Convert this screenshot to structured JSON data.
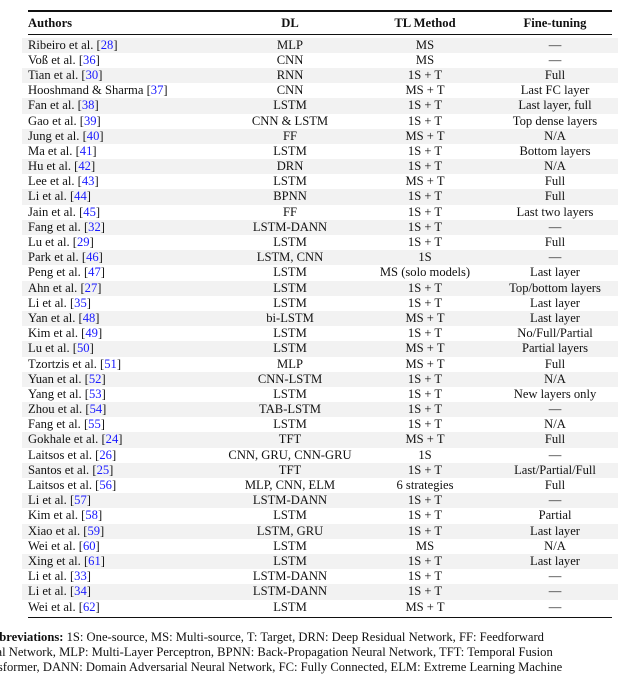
{
  "table": {
    "headers": [
      "Authors",
      "DL",
      "TL Method",
      "Fine-tuning"
    ],
    "rows": [
      {
        "author": "Ribeiro et al.",
        "ref": "28",
        "dl": "MLP",
        "tl": "MS",
        "ft": "—"
      },
      {
        "author": "Voß et al.",
        "ref": "36",
        "dl": "CNN",
        "tl": "MS",
        "ft": "—"
      },
      {
        "author": "Tian et al.",
        "ref": "30",
        "dl": "RNN",
        "tl": "1S + T",
        "ft": "Full"
      },
      {
        "author": "Hooshmand & Sharma",
        "ref": "37",
        "dl": "CNN",
        "tl": "MS + T",
        "ft": "Last FC layer"
      },
      {
        "author": "Fan et al.",
        "ref": "38",
        "dl": "LSTM",
        "tl": "1S + T",
        "ft": "Last layer, full"
      },
      {
        "author": "Gao et al.",
        "ref": "39",
        "dl": "CNN & LSTM",
        "tl": "1S + T",
        "ft": "Top dense layers"
      },
      {
        "author": "Jung et al.",
        "ref": "40",
        "dl": "FF",
        "tl": "MS + T",
        "ft": "N/A"
      },
      {
        "author": "Ma et al.",
        "ref": "41",
        "dl": "LSTM",
        "tl": "1S + T",
        "ft": "Bottom layers"
      },
      {
        "author": "Hu et al.",
        "ref": "42",
        "dl": "DRN",
        "tl": "1S + T",
        "ft": "N/A"
      },
      {
        "author": "Lee et al.",
        "ref": "43",
        "dl": "LSTM",
        "tl": "MS + T",
        "ft": "Full"
      },
      {
        "author": "Li et al.",
        "ref": "44",
        "dl": "BPNN",
        "tl": "1S + T",
        "ft": "Full"
      },
      {
        "author": "Jain et al.",
        "ref": "45",
        "dl": "FF",
        "tl": "1S + T",
        "ft": "Last two layers"
      },
      {
        "author": "Fang et al.",
        "ref": "32",
        "dl": "LSTM-DANN",
        "tl": "1S + T",
        "ft": "—"
      },
      {
        "author": "Lu et al.",
        "ref": "29",
        "dl": "LSTM",
        "tl": "1S + T",
        "ft": "Full"
      },
      {
        "author": "Park et al.",
        "ref": "46",
        "dl": "LSTM, CNN",
        "tl": "1S",
        "ft": "—"
      },
      {
        "author": "Peng et al.",
        "ref": "47",
        "dl": "LSTM",
        "tl": "MS (solo models)",
        "ft": "Last layer"
      },
      {
        "author": "Ahn et al.",
        "ref": "27",
        "dl": "LSTM",
        "tl": "1S + T",
        "ft": "Top/bottom layers"
      },
      {
        "author": "Li et al.",
        "ref": "35",
        "dl": "LSTM",
        "tl": "1S + T",
        "ft": "Last layer"
      },
      {
        "author": "Yan et al.",
        "ref": "48",
        "dl": "bi-LSTM",
        "tl": "MS + T",
        "ft": "Last layer"
      },
      {
        "author": "Kim et al.",
        "ref": "49",
        "dl": "LSTM",
        "tl": "1S + T",
        "ft": "No/Full/Partial"
      },
      {
        "author": "Lu et al.",
        "ref": "50",
        "dl": "LSTM",
        "tl": "MS + T",
        "ft": "Partial layers"
      },
      {
        "author": "Tzortzis et al.",
        "ref": "51",
        "dl": "MLP",
        "tl": "MS + T",
        "ft": "Full"
      },
      {
        "author": "Yuan et al.",
        "ref": "52",
        "dl": "CNN-LSTM",
        "tl": "1S + T",
        "ft": "N/A"
      },
      {
        "author": "Yang et al.",
        "ref": "53",
        "dl": "LSTM",
        "tl": "1S + T",
        "ft": "New layers only"
      },
      {
        "author": "Zhou et al.",
        "ref": "54",
        "dl": "TAB-LSTM",
        "tl": "1S + T",
        "ft": "—"
      },
      {
        "author": "Fang et al.",
        "ref": "55",
        "dl": "LSTM",
        "tl": "1S + T",
        "ft": "N/A"
      },
      {
        "author": "Gokhale et al.",
        "ref": "24",
        "dl": "TFT",
        "tl": "MS + T",
        "ft": "Full"
      },
      {
        "author": "Laitsos et al.",
        "ref": "26",
        "dl": "CNN, GRU, CNN-GRU",
        "tl": "1S",
        "ft": "—"
      },
      {
        "author": "Santos et al.",
        "ref": "25",
        "dl": "TFT",
        "tl": "1S + T",
        "ft": "Last/Partial/Full"
      },
      {
        "author": "Laitsos et al.",
        "ref": "56",
        "dl": "MLP, CNN, ELM",
        "tl": "6 strategies",
        "ft": "Full"
      },
      {
        "author": "Li et al.",
        "ref": "57",
        "dl": "LSTM-DANN",
        "tl": "1S + T",
        "ft": "—"
      },
      {
        "author": "Kim et al.",
        "ref": "58",
        "dl": "LSTM",
        "tl": "1S + T",
        "ft": "Partial"
      },
      {
        "author": "Xiao et al.",
        "ref": "59",
        "dl": "LSTM, GRU",
        "tl": "1S + T",
        "ft": "Last layer"
      },
      {
        "author": "Wei et al.",
        "ref": "60",
        "dl": "LSTM",
        "tl": "MS",
        "ft": "N/A"
      },
      {
        "author": "Xing et al.",
        "ref": "61",
        "dl": "LSTM",
        "tl": "1S + T",
        "ft": "Last layer"
      },
      {
        "author": "Li et al.",
        "ref": "33",
        "dl": "LSTM-DANN",
        "tl": "1S + T",
        "ft": "—"
      },
      {
        "author": "Li et al.",
        "ref": "34",
        "dl": "LSTM-DANN",
        "tl": "1S + T",
        "ft": "—"
      },
      {
        "author": "Wei et al.",
        "ref": "62",
        "dl": "LSTM",
        "tl": "MS + T",
        "ft": "—"
      }
    ]
  },
  "footnote": {
    "label": "obbreviations:",
    "lines": [
      "1S: One-source, MS: Multi-source, T: Target, DRN: Deep Residual Network, FF: Feedforward",
      "ural Network, MLP: Multi-Layer Perceptron, BPNN: Back-Propagation Neural Network, TFT: Temporal Fusion",
      "ansformer, DANN: Domain Adversarial Neural Network, FC: Fully Connected, ELM: Extreme Learning Machine"
    ]
  },
  "colors": {
    "link": "#1a1aff",
    "row_shade": "#f2f2f2"
  }
}
